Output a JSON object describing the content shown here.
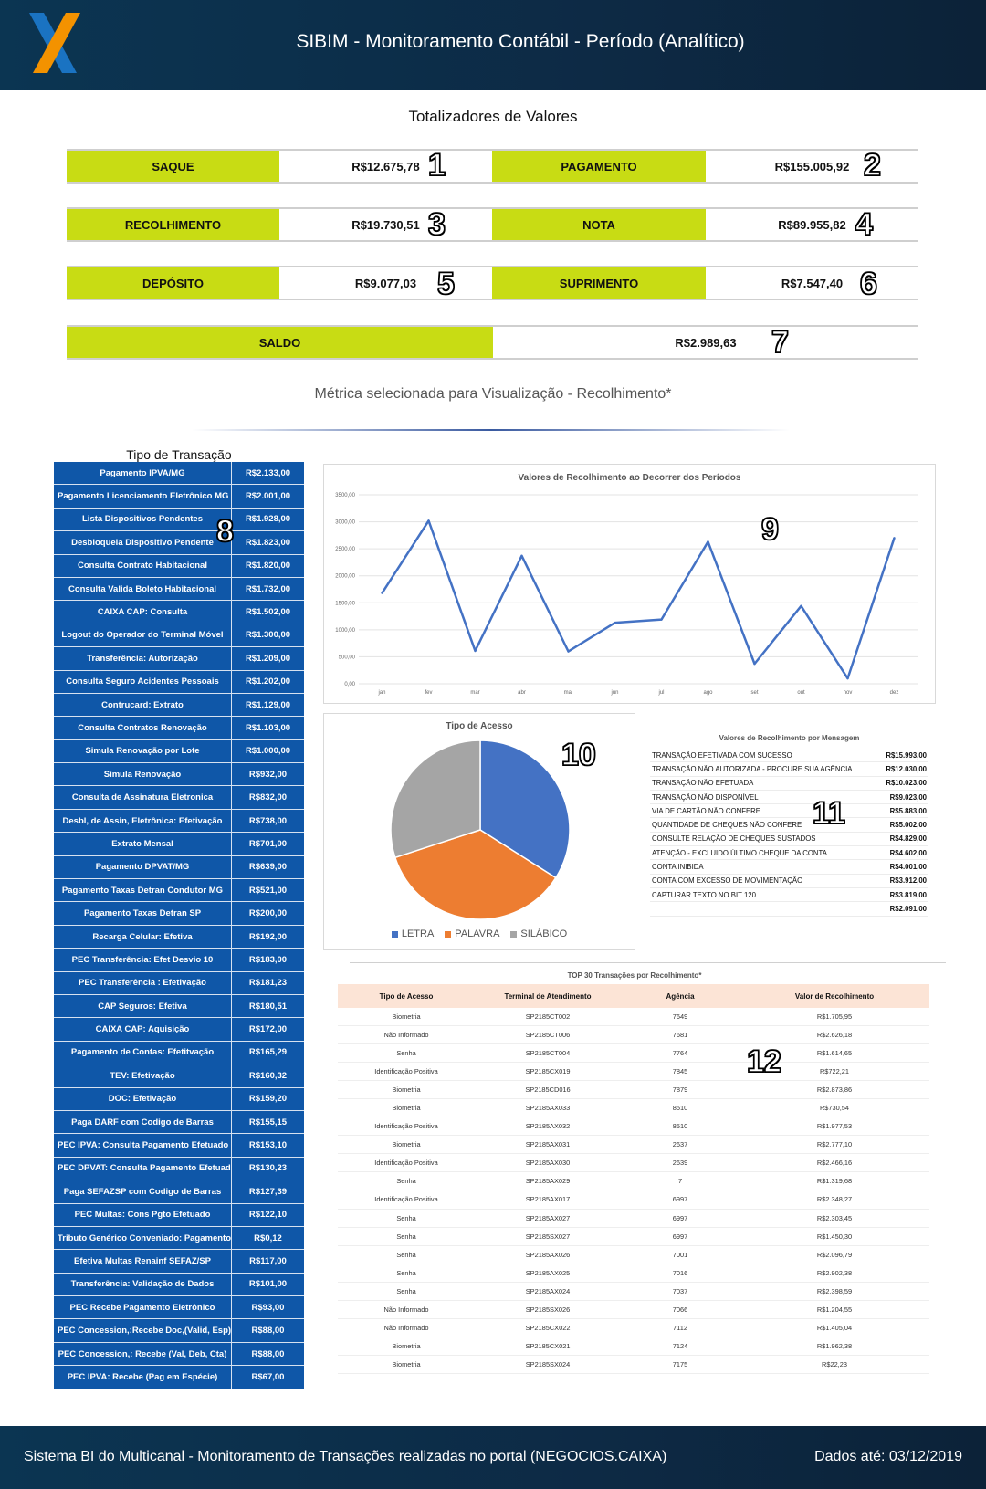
{
  "header": {
    "title": "SIBIM - Monitoramento Contábil - Período (Analítico)"
  },
  "totals_title": "Totalizadores de Valores",
  "totals": {
    "saque": {
      "label": "SAQUE",
      "value": "R$12.675,78",
      "badge": "1"
    },
    "pagamento": {
      "label": "PAGAMENTO",
      "value": "R$155.005,92",
      "badge": "2"
    },
    "recolhimento": {
      "label": "RECOLHIMENTO",
      "value": "R$19.730,51",
      "badge": "3"
    },
    "nota": {
      "label": "NOTA",
      "value": "R$89.955,82",
      "badge": "4"
    },
    "deposito": {
      "label": "DEPÓSITO",
      "value": "R$9.077,03",
      "badge": "5"
    },
    "suprimento": {
      "label": "SUPRIMENTO",
      "value": "R$7.547,40",
      "badge": "6"
    },
    "saldo": {
      "label": "SALDO",
      "value": "R$2.989,63",
      "badge": "7"
    }
  },
  "metric_selected": "Métrica selecionada para Visualização - Recolhimento*",
  "transaction_types": {
    "title": "Tipo de Transação",
    "badge": "8",
    "rows": [
      {
        "name": "Pagamento IPVA/MG",
        "value": "R$2.133,00"
      },
      {
        "name": "Pagamento Licenciamento Eletrônico MG",
        "value": "R$2.001,00"
      },
      {
        "name": "Lista Dispositivos Pendentes",
        "value": "R$1.928,00"
      },
      {
        "name": "Desbloqueia Dispositivo Pendente",
        "value": "R$1.823,00"
      },
      {
        "name": "Consulta Contrato Habitacional",
        "value": "R$1.820,00"
      },
      {
        "name": "Consulta Valida Boleto Habitacional",
        "value": "R$1.732,00"
      },
      {
        "name": "CAIXA CAP: Consulta",
        "value": "R$1.502,00"
      },
      {
        "name": "Logout do Operador do Terminal Móvel",
        "value": "R$1.300,00"
      },
      {
        "name": "Transferência: Autorização",
        "value": "R$1.209,00"
      },
      {
        "name": "Consulta Seguro Acidentes Pessoais",
        "value": "R$1.202,00"
      },
      {
        "name": "Contrucard: Extrato",
        "value": "R$1.129,00"
      },
      {
        "name": "Consulta Contratos Renovação",
        "value": "R$1.103,00"
      },
      {
        "name": "Simula Renovação por Lote",
        "value": "R$1.000,00"
      },
      {
        "name": "Simula Renovação",
        "value": "R$932,00"
      },
      {
        "name": "Consulta de Assinatura Eletronica",
        "value": "R$832,00"
      },
      {
        "name": "Desbl, de Assin, Eletrônica: Efetivação",
        "value": "R$738,00"
      },
      {
        "name": "Extrato Mensal",
        "value": "R$701,00"
      },
      {
        "name": "Pagamento DPVAT/MG",
        "value": "R$639,00"
      },
      {
        "name": "Pagamento Taxas Detran Condutor MG",
        "value": "R$521,00"
      },
      {
        "name": "Pagamento Taxas Detran SP",
        "value": "R$200,00"
      },
      {
        "name": "Recarga Celular: Efetiva",
        "value": "R$192,00"
      },
      {
        "name": "PEC  Transferência: Efet Desvio 10",
        "value": "R$183,00"
      },
      {
        "name": "PEC  Transferência : Efetivação",
        "value": "R$181,23"
      },
      {
        "name": "CAP Seguros: Efetiva",
        "value": "R$180,51"
      },
      {
        "name": "CAIXA CAP: Aquisição",
        "value": "R$172,00"
      },
      {
        "name": "Pagamento de Contas: Efetitvação",
        "value": "R$165,29"
      },
      {
        "name": "TEV: Efetivação",
        "value": "R$160,32"
      },
      {
        "name": "DOC: Efetivação",
        "value": "R$159,20"
      },
      {
        "name": "Paga DARF com Codigo de Barras",
        "value": "R$155,15"
      },
      {
        "name": "PEC  IPVA: Consulta Pagamento Efetuado",
        "value": "R$153,10"
      },
      {
        "name": "PEC  DPVAT: Consulta Pagamento Efetuado",
        "value": "R$130,23"
      },
      {
        "name": "Paga SEFAZSP com Codigo de Barras",
        "value": "R$127,39"
      },
      {
        "name": "PEC  Multas: Cons Pgto Efetuado",
        "value": "R$122,10"
      },
      {
        "name": "Tributo Genérico Conveniado: Pagamento",
        "value": "R$0,12"
      },
      {
        "name": "Efetiva Multas Renainf SEFAZ/SP",
        "value": "R$117,00"
      },
      {
        "name": "Transferência: Validação de Dados",
        "value": "R$101,00"
      },
      {
        "name": "PEC  Recebe Pagamento Eletrônico",
        "value": "R$93,00"
      },
      {
        "name": "PEC Concession,:Recebe Doc,(Valid, Esp)",
        "value": "R$88,00"
      },
      {
        "name": "PEC Concession,: Recebe (Val, Deb, Cta)",
        "value": "R$88,00"
      },
      {
        "name": "PEC  IPVA: Recebe (Pag em Espécie)",
        "value": "R$67,00"
      }
    ]
  },
  "chart_data": [
    {
      "type": "line",
      "title": "Valores de Recolhimento ao Decorrer dos Períodos",
      "badge": "9",
      "categories": [
        "jan",
        "fev",
        "mar",
        "abr",
        "mai",
        "jun",
        "jul",
        "ago",
        "set",
        "out",
        "nov",
        "dez"
      ],
      "values": [
        1680,
        3020,
        610,
        2370,
        600,
        1130,
        1190,
        2630,
        370,
        1440,
        100,
        2700
      ],
      "ylim": [
        0,
        3500
      ],
      "yticks": [
        "0,00",
        "500,00",
        "1000,00",
        "1500,00",
        "2000,00",
        "2500,00",
        "3000,00",
        "3500,00"
      ],
      "grid": true,
      "color": "#4472c4"
    },
    {
      "type": "pie",
      "title": "Tipo de Acesso",
      "badge": "10",
      "series": [
        {
          "name": "LETRA",
          "value": 34,
          "color": "#4472c4"
        },
        {
          "name": "PALAVRA",
          "value": 36,
          "color": "#ed7d31"
        },
        {
          "name": "SILÁBICO",
          "value": 30,
          "color": "#a5a5a5"
        }
      ]
    }
  ],
  "messages": {
    "title": "Valores de Recolhimento por Mensagem",
    "badge": "11",
    "rows": [
      {
        "name": "TRANSAÇÃO EFETIVADA COM SUCESSO",
        "value": "R$15.993,00"
      },
      {
        "name": "TRANSAÇÃO NÃO AUTORIZADA - PROCURE SUA AGÊNCIA",
        "value": "R$12.030,00"
      },
      {
        "name": "TRANSAÇÃO NÃO EFETUADA",
        "value": "R$10.023,00"
      },
      {
        "name": "TRANSAÇÃO NÃO DISPONÍVEL",
        "value": "R$9.023,00"
      },
      {
        "name": "VIA DE CARTÃO NÃO CONFERE",
        "value": "R$5.883,00"
      },
      {
        "name": "QUANTIDADE DE CHEQUES NÃO CONFERE",
        "value": "R$5.002,00"
      },
      {
        "name": "CONSULTE RELAÇÃO DE CHEQUES SUSTADOS",
        "value": "R$4.829,00"
      },
      {
        "name": "ATENÇÃO - EXCLUIDO ÚLTIMO CHEQUE DA CONTA",
        "value": "R$4.602,00"
      },
      {
        "name": "CONTA INIBIDA",
        "value": "R$4.001,00"
      },
      {
        "name": "CONTA COM EXCESSO DE MOVIMENTAÇÃO",
        "value": "R$3.912,00"
      },
      {
        "name": "CAPTURAR TEXTO NO BIT 120",
        "value": "R$3.819,00"
      },
      {
        "name": "",
        "value": "R$2.091,00"
      }
    ]
  },
  "top30": {
    "title": "TOP 30 Transações por Recolhimento*",
    "badge": "12",
    "headers": [
      "Tipo de Acesso",
      "Terminal de Atendimento",
      "Agência",
      "Valor de Recolhimento"
    ],
    "rows": [
      [
        "Biometria",
        "SP2185CT002",
        "7649",
        "R$1.705,95"
      ],
      [
        "Não Informado",
        "SP2185CT006",
        "7681",
        "R$2.626,18"
      ],
      [
        "Senha",
        "SP2185CT004",
        "7764",
        "R$1.614,65"
      ],
      [
        "Identificação Positiva",
        "SP2185CX019",
        "7845",
        "R$722,21"
      ],
      [
        "Biometria",
        "SP2185CD016",
        "7879",
        "R$2.873,86"
      ],
      [
        "Biometria",
        "SP2185AX033",
        "8510",
        "R$730,54"
      ],
      [
        "Identificação Positiva",
        "SP2185AX032",
        "8510",
        "R$1.977,53"
      ],
      [
        "Biometria",
        "SP2185AX031",
        "2637",
        "R$2.777,10"
      ],
      [
        "Identificação Positiva",
        "SP2185AX030",
        "2639",
        "R$2.466,16"
      ],
      [
        "Senha",
        "SP2185AX029",
        "7",
        "R$1.319,68"
      ],
      [
        "Identificação Positiva",
        "SP2185AX017",
        "6997",
        "R$2.348,27"
      ],
      [
        "Senha",
        "SP2185AX027",
        "6997",
        "R$2.303,45"
      ],
      [
        "Senha",
        "SP2185SX027",
        "6997",
        "R$1.450,30"
      ],
      [
        "Senha",
        "SP2185AX026",
        "7001",
        "R$2.096,79"
      ],
      [
        "Senha",
        "SP2185AX025",
        "7016",
        "R$2.902,38"
      ],
      [
        "Senha",
        "SP2185AX024",
        "7037",
        "R$2.398,59"
      ],
      [
        "Não Informado",
        "SP2185SX026",
        "7066",
        "R$1.204,55"
      ],
      [
        "Não Informado",
        "SP2185CX022",
        "7112",
        "R$1.405,04"
      ],
      [
        "Biometria",
        "SP2185CX021",
        "7124",
        "R$1.962,38"
      ],
      [
        "Biometria",
        "SP2185SX024",
        "7175",
        "R$22,23"
      ]
    ]
  },
  "footer": {
    "left": "Sistema BI do Multicanal - Monitoramento de Transações realizadas no portal (NEGOCIOS.CAIXA)",
    "right": "Dados até: 03/12/2019"
  }
}
